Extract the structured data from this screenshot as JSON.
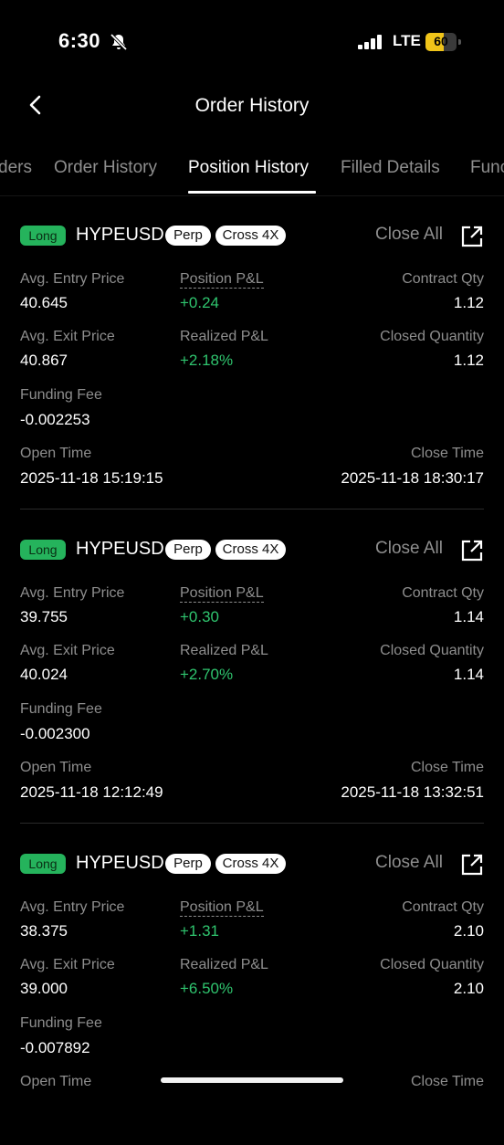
{
  "status_bar": {
    "time": "6:30",
    "network": "LTE",
    "battery": "60",
    "battery_level": 0.6
  },
  "nav": {
    "title": "Order History"
  },
  "tabs": [
    {
      "label": "ders"
    },
    {
      "label": "Order History"
    },
    {
      "label": "Position History"
    },
    {
      "label": "Filled Details"
    },
    {
      "label": "Func"
    }
  ],
  "labels": {
    "long": "Long",
    "perp": "Perp",
    "close_all": "Close All",
    "avg_entry_price": "Avg. Entry Price",
    "position_pnl": "Position P&L",
    "contract_qty": "Contract Qty",
    "avg_exit_price": "Avg. Exit Price",
    "realized_pnl": "Realized P&L",
    "closed_quantity": "Closed Quantity",
    "funding_fee": "Funding Fee",
    "open_time": "Open Time",
    "close_time": "Close Time"
  },
  "colors": {
    "long_green": "#25b35c",
    "pnl_green": "#2fc46e",
    "muted": "#8e8e8e"
  },
  "positions": [
    {
      "symbol": "HYPEUSD",
      "margin": "Cross 4X",
      "avg_entry_price": "40.645",
      "position_pnl": "+0.24",
      "contract_qty": "1.12",
      "avg_exit_price": "40.867",
      "realized_pnl": "+2.18%",
      "closed_quantity": "1.12",
      "funding_fee": "-0.002253",
      "open_time": "2025-11-18 15:19:15",
      "close_time": "2025-11-18 18:30:17"
    },
    {
      "symbol": "HYPEUSD",
      "margin": "Cross 4X",
      "avg_entry_price": "39.755",
      "position_pnl": "+0.30",
      "contract_qty": "1.14",
      "avg_exit_price": "40.024",
      "realized_pnl": "+2.70%",
      "closed_quantity": "1.14",
      "funding_fee": "-0.002300",
      "open_time": "2025-11-18 12:12:49",
      "close_time": "2025-11-18 13:32:51"
    },
    {
      "symbol": "HYPEUSD",
      "margin": "Cross 4X",
      "avg_entry_price": "38.375",
      "position_pnl": "+1.31",
      "contract_qty": "2.10",
      "avg_exit_price": "39.000",
      "realized_pnl": "+6.50%",
      "closed_quantity": "2.10",
      "funding_fee": "-0.007892",
      "open_time": "",
      "close_time": ""
    }
  ]
}
